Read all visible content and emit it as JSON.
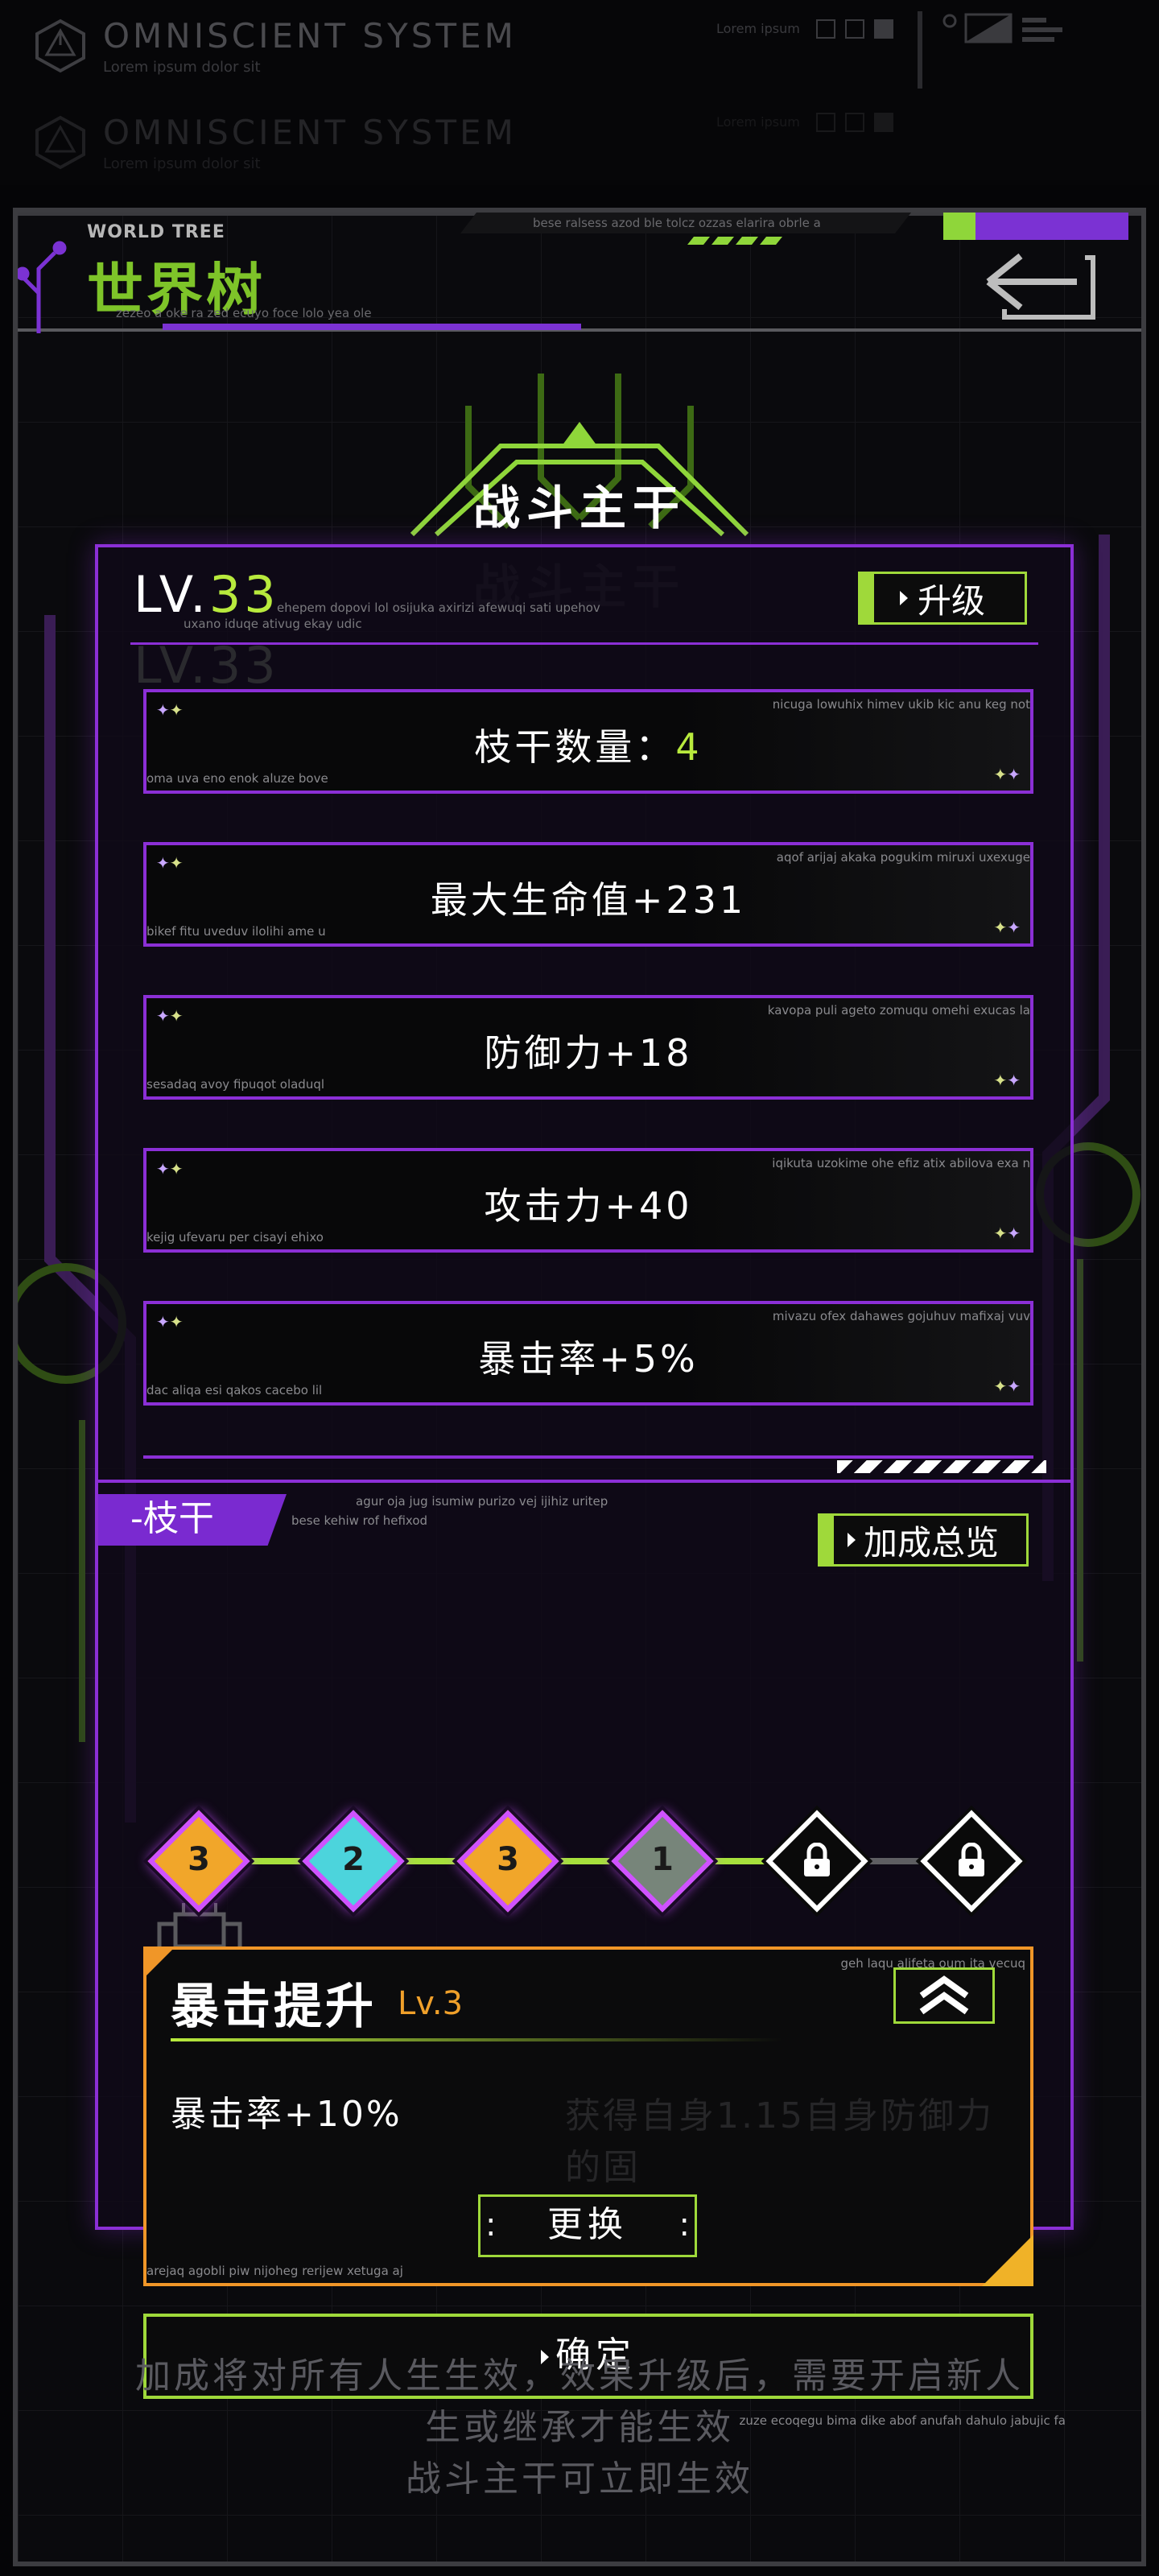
{
  "ghost_header": {
    "title": "OMNISCIENT SYSTEM",
    "subtitle": "Lorem ipsum dolor sit",
    "right_label": "Lorem ipsum"
  },
  "header": {
    "title_en": "WORLD TREE",
    "title_cn": "世界树",
    "lorem_bottom": "zezeo a oke ra zed ecuyo foce lolo yea ole",
    "lorem_top": "bese ralsess azod ble tolcz ozzas elarira obrle a"
  },
  "page_title": "战斗主干",
  "level": {
    "prefix": "LV.",
    "value": "33",
    "lorem1": "ehepem dopovi lol osijuka axirizi afewuqi sati upehov",
    "lorem2": "uxano iduqe ativug ekay udic",
    "upgrade_label": "升级"
  },
  "stats": [
    {
      "label": "枝干数量：",
      "highlight": "4",
      "lorem_left": "oma uva eno enok aluze bove",
      "lorem_right": "nicuga lowuhix himev ukib kic anu keg not"
    },
    {
      "label": "最大生命值+231",
      "highlight": "",
      "lorem_left": "bikef fitu uveduv ilolihi ame u",
      "lorem_right": "aqof arijaj akaka pogukim miruxi uxexuge"
    },
    {
      "label": "防御力+18",
      "highlight": "",
      "lorem_left": "sesadaq avoy fipuqot oladuql",
      "lorem_right": "kavopa puli ageto zomuqu omehi exucas la"
    },
    {
      "label": "攻击力+40",
      "highlight": "",
      "lorem_left": "kejig ufevaru per cisayi ehixo",
      "lorem_right": "iqikuta uzokime ohe efiz atix abilova exa n"
    },
    {
      "label": "暴击率+5%",
      "highlight": "",
      "lorem_left": "dac aliqa esi qakos cacebo lil",
      "lorem_right": "mivazu ofex dahawes gojuhuv mafixaj vuv"
    }
  ],
  "branch": {
    "tag": "-枝干",
    "lorem1": "agur oja jug isumiw purizo vej ijihiz uritep",
    "lorem2": "bese kehiw rof hefixod",
    "overview_label": "加成总览"
  },
  "nodes": [
    {
      "label": "3",
      "color": "#f1a62a",
      "locked": false
    },
    {
      "label": "2",
      "color": "#4cd4dc",
      "locked": false
    },
    {
      "label": "3",
      "color": "#f1a62a",
      "locked": false
    },
    {
      "label": "1",
      "color": "#77857a",
      "locked": false
    },
    {
      "label": "",
      "color": "#ffffff",
      "locked": true
    },
    {
      "label": "",
      "color": "#ffffff",
      "locked": true
    }
  ],
  "skill": {
    "name": "暴击提升",
    "level": "Lv.3",
    "effect": "暴击率+10%",
    "effect_ghost": "获得自身1.15自身防御力的固",
    "swap_label": "更换",
    "lorem_right": "geh laqu alifeta oum ita vecuq",
    "lorem_left": "arejaq agobli piw nijoheg rerijew xetuga aj"
  },
  "confirm": {
    "label": "确定",
    "lorem": "zuze ecoqegu bima dike abof anufah dahulo jabujic fa"
  },
  "footer": {
    "line1": "加成将对所有人生生效，效果升级后，需要开启新人",
    "line2": "生或继承才能生效",
    "line3": "战斗主干可立即生效"
  },
  "colors": {
    "purple": "#8b2fd6",
    "green": "#9fd93a",
    "lime_text": "#b8ea3d",
    "orange": "#f09628"
  }
}
